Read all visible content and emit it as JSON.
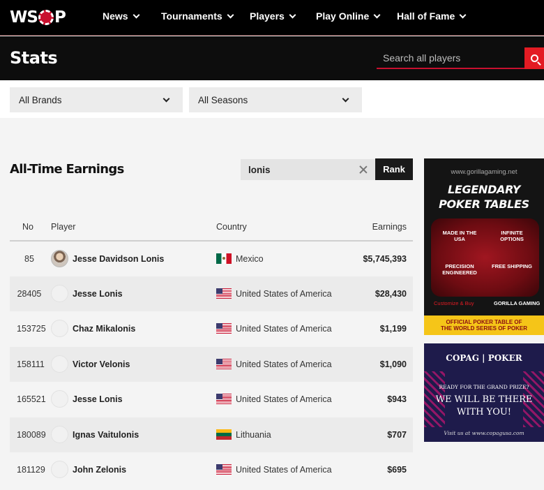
{
  "nav": {
    "logo_text": "WSOP",
    "items": [
      {
        "label": "News"
      },
      {
        "label": "Tournaments"
      },
      {
        "label": "Players"
      },
      {
        "label": "Play Online"
      },
      {
        "label": "Hall of Fame"
      }
    ]
  },
  "stats": {
    "title": "Stats",
    "search_placeholder": "Search all players"
  },
  "filters": {
    "brand": "All Brands",
    "season": "All Seasons"
  },
  "earnings": {
    "title": "All-Time Earnings",
    "search_value": "lonis",
    "rank_label": "Rank",
    "columns": {
      "no": "No",
      "player": "Player",
      "country": "Country",
      "earnings": "Earnings"
    },
    "rows": [
      {
        "no": "85",
        "player": "Jesse Davidson Lonis",
        "country": "Mexico",
        "earnings": "$5,745,393"
      },
      {
        "no": "28405",
        "player": "Jesse Lonis",
        "country": "United States of America",
        "earnings": "$28,430"
      },
      {
        "no": "153725",
        "player": "Chaz Mikalonis",
        "country": "United States of America",
        "earnings": "$1,199"
      },
      {
        "no": "158111",
        "player": "Victor Velonis",
        "country": "United States of America",
        "earnings": "$1,090"
      },
      {
        "no": "165521",
        "player": "Jesse Lonis",
        "country": "United States of America",
        "earnings": "$943"
      },
      {
        "no": "180089",
        "player": "Ignas Vaitulonis",
        "country": "Lithuania",
        "earnings": "$707"
      },
      {
        "no": "181129",
        "player": "John Zelonis",
        "country": "United States of America",
        "earnings": "$695"
      }
    ]
  },
  "ads": {
    "gorilla": {
      "url": "www.gorillagaming.net",
      "headline_1": "LEGENDARY",
      "headline_2": "POKER TABLES",
      "f1": "MADE IN THE USA",
      "f2": "INFINITE OPTIONS",
      "f3": "PRECISION ENGINEERED",
      "f4": "FREE SHIPPING",
      "tagline": "Customize & Buy",
      "brand": "GORILLA GAMING",
      "banner_1": "OFFICIAL POKER TABLE OF",
      "banner_2": "THE WORLD SERIES OF POKER"
    },
    "copag": {
      "logos": "COPAG | POKER",
      "question": "READY FOR THE GRAND PRIZE?",
      "line_1": "WE WILL BE THERE",
      "line_2": "WITH YOU!",
      "visit": "Visit us at www.copagusa.com"
    }
  },
  "colors": {
    "accent": "#e31b23",
    "topbar": "#000000",
    "ad_gold": "#f5c518",
    "ad_navy": "#1e1b4b"
  }
}
